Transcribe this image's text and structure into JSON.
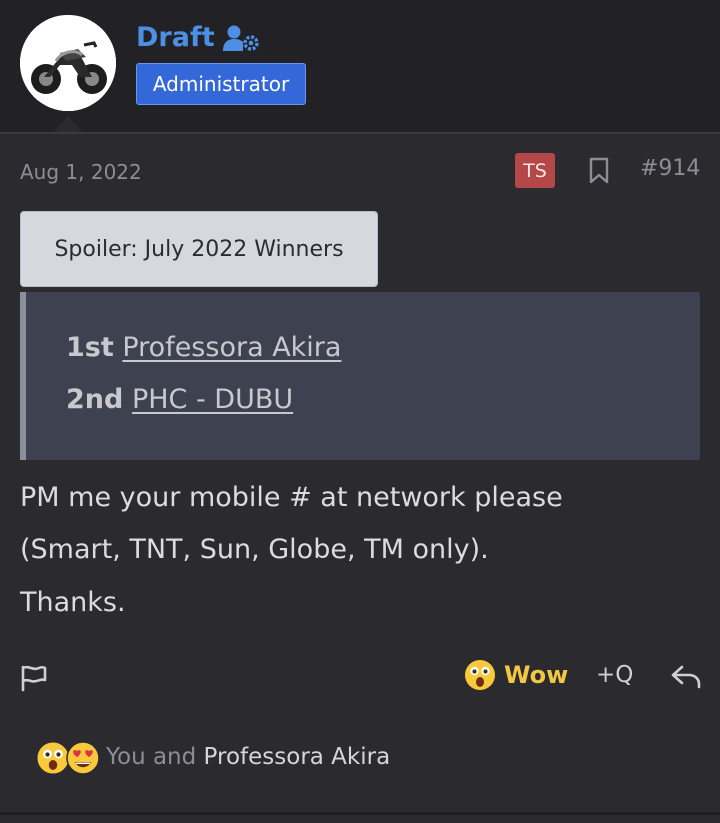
{
  "post": {
    "author": {
      "name": "Draft",
      "role": "Administrator",
      "avatar_icon": "motorcycle-avatar",
      "staff_icon": "user-cog-icon"
    },
    "date": "Aug 1, 2022",
    "ts_badge": "TS",
    "number": "#914",
    "spoiler": {
      "label": "Spoiler: July 2022 Winners",
      "winners": [
        {
          "rank": "1st",
          "name": "Professora Akira"
        },
        {
          "rank": "2nd",
          "name": "PHC - DUBU"
        }
      ]
    },
    "body": [
      "PM me your mobile # at network please",
      "(Smart, TNT, Sun, Globe, TM only).",
      "Thanks."
    ],
    "actions": {
      "report_icon": "flag-icon",
      "reaction_label": "Wow",
      "quote_label": "+Q",
      "reply_icon": "reply-icon"
    },
    "reactions": {
      "prefix": "You and",
      "name": "Professora Akira",
      "icons": [
        "wow-emoji",
        "heart-eyes-emoji"
      ]
    }
  },
  "colors": {
    "background": "#2a2a2f",
    "header": "#222226",
    "author": "#4e8fe6",
    "badge": "#3468d8",
    "ts": "#b44848",
    "wow": "#f2c744"
  }
}
